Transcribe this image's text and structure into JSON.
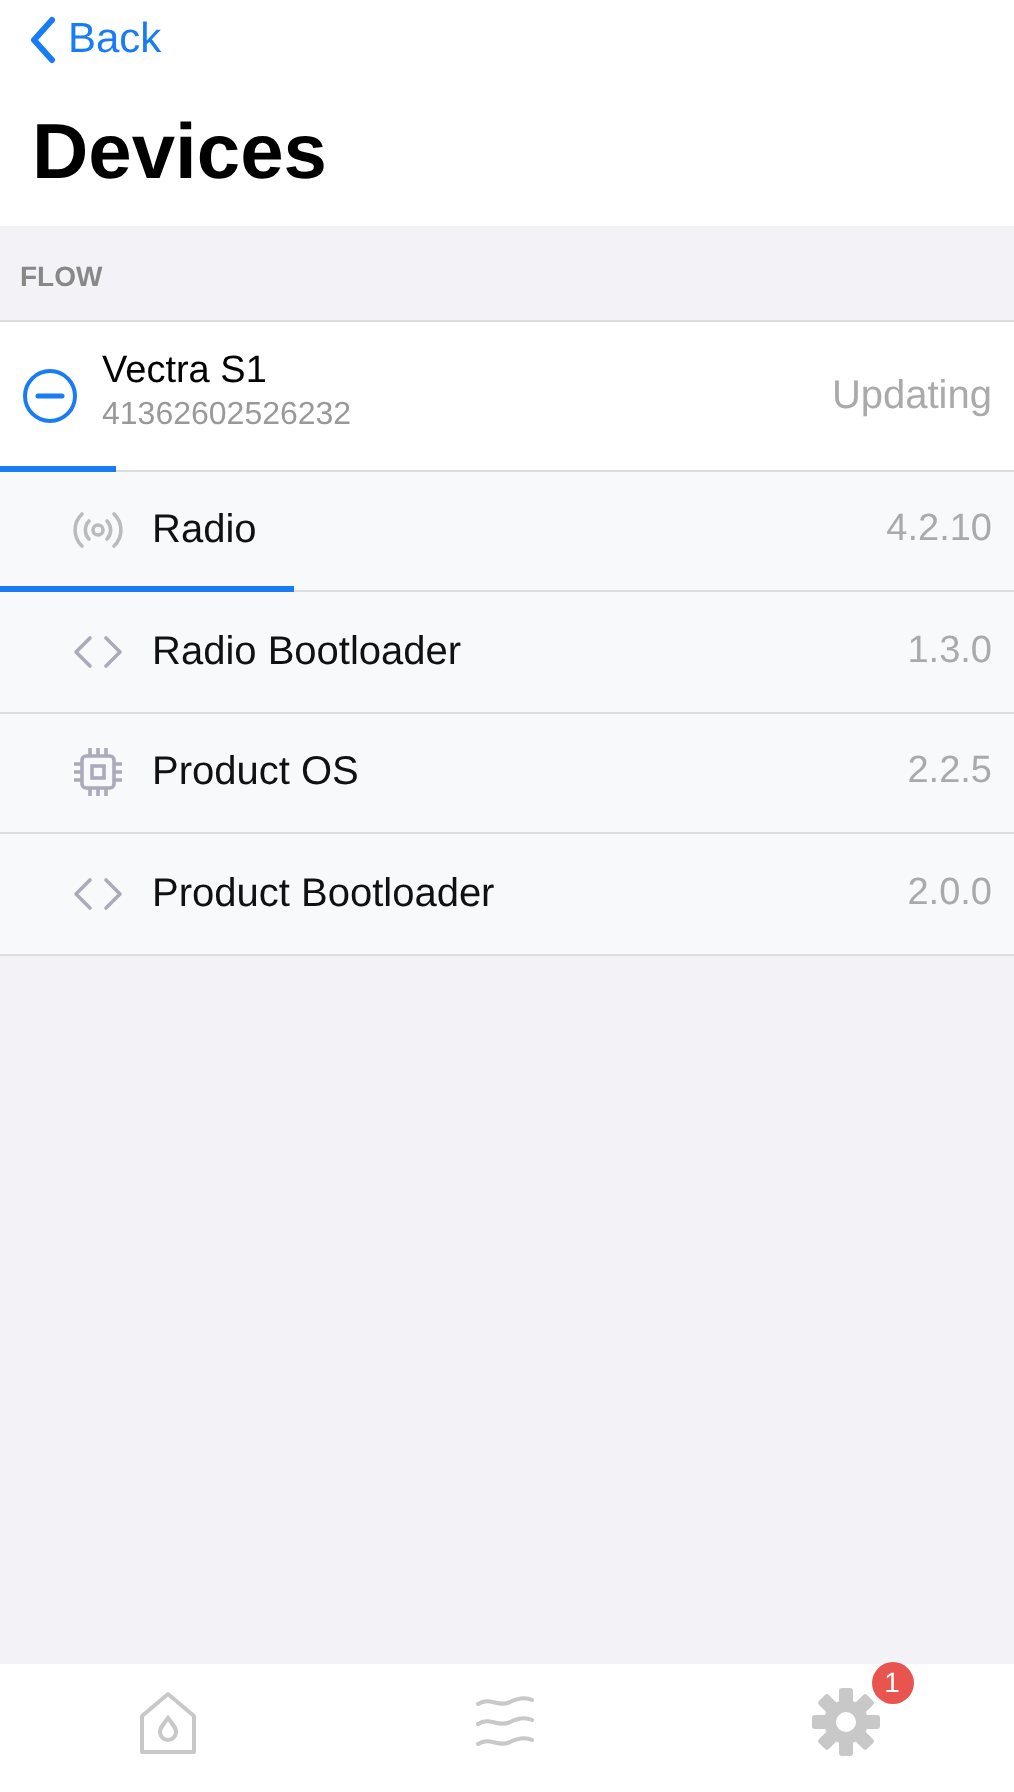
{
  "nav": {
    "back": "Back",
    "title": "Devices"
  },
  "section": {
    "header": "FLOW"
  },
  "device": {
    "name": "Vectra S1",
    "serial": "41362602526232",
    "status": "Updating",
    "level": 0.115
  },
  "components": [
    {
      "kind": "radio",
      "name": "Radio",
      "version": "4.2.10",
      "level": 0.29
    },
    {
      "kind": "code",
      "name": "Radio Bootloader",
      "version": "1.3.0"
    },
    {
      "kind": "chip",
      "name": "Product OS",
      "version": "2.2.5"
    },
    {
      "kind": "code",
      "name": "Product Bootloader",
      "version": "2.0.0"
    }
  ],
  "tab_bar": {
    "tabs": [
      {
        "kind": "home"
      },
      {
        "kind": "waves"
      },
      {
        "kind": "gear",
        "badge": "1"
      }
    ]
  }
}
